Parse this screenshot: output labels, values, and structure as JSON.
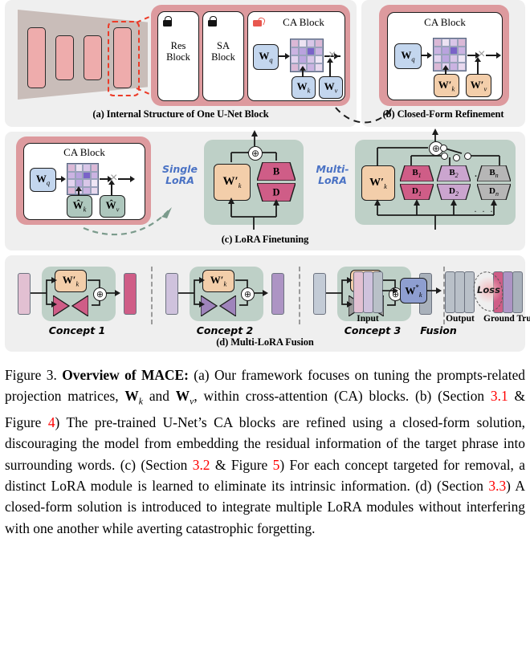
{
  "figure": {
    "panels": {
      "a": {
        "label": "(a) Internal Structure of One U-Net Block",
        "blocks": [
          {
            "name_line1": "Res",
            "name_line2": "Block",
            "lock": "closed-lock-icon"
          },
          {
            "name_line1": "SA",
            "name_line2": "Block",
            "lock": "closed-lock-icon"
          }
        ],
        "ca_title": "CA Block",
        "ca_lock": "open-lock-icon",
        "nodes": {
          "wq": "W",
          "wq_sub": "q",
          "wk": "W",
          "wk_sub": "k",
          "wv": "W",
          "wv_sub": "v"
        },
        "multiply_symbol": "×"
      },
      "b": {
        "label": "(b) Closed-Form Refinement",
        "ca_title": "CA Block",
        "nodes": {
          "wq": "W",
          "wq_sub": "q",
          "wk": "W′",
          "wk_sub": "k",
          "wv": "W′",
          "wv_sub": "v"
        },
        "multiply_symbol": "×"
      },
      "c": {
        "label": "(c) LoRA Finetuning",
        "ca_title": "CA Block",
        "nodes": {
          "wq": "W",
          "wq_sub": "q",
          "wk": "Ŵ",
          "wk_sub": "k",
          "wv": "Ŵ",
          "wv_sub": "v"
        },
        "multiply_symbol": "×",
        "single_lora_label": "Single\nLoRA",
        "single_lora_line1": "Single",
        "single_lora_line2": "LoRA",
        "multi_lora_line1": "Multi-",
        "multi_lora_line2": "LoRA",
        "single": {
          "w": "W′",
          "w_sub": "k",
          "b": "B",
          "d": "D"
        },
        "multi": {
          "w": "W′",
          "w_sub": "k",
          "pairs": [
            {
              "b": "B",
              "b_sub": "1",
              "d": "D",
              "d_sub": "1",
              "color": "#cf5d87"
            },
            {
              "b": "B",
              "b_sub": "2",
              "d": "D",
              "d_sub": "2",
              "color": "#cba5cf"
            },
            {
              "b": "B",
              "b_sub": "n",
              "d": "D",
              "d_sub": "n",
              "color": "#b6b6b6"
            }
          ],
          "ellipsis": "· · ·"
        },
        "sum_symbol": "⊕"
      },
      "d": {
        "label": "(d) Multi-LoRA Fusion",
        "concepts": [
          {
            "name": "Concept 1",
            "color": "#cf5d87",
            "in_color": "#e2c0d2"
          },
          {
            "name": "Concept 2",
            "color": "#9f84bb",
            "in_color": "#cfc2dd"
          },
          {
            "name": "Concept 3",
            "color": "#9a9a9a",
            "in_color": "#c3cbd6"
          }
        ],
        "concept_node": {
          "w": "W′",
          "w_sub": "k"
        },
        "sum_symbol": "⊕",
        "fusion": {
          "title": "Fusion",
          "input_label": "Input",
          "output_label": "Output",
          "gt_label": "Ground Truth",
          "loss_label": "Loss",
          "node": {
            "w": "W",
            "w_sup": "*",
            "w_sub": "k"
          },
          "input_colors": [
            "#e2c0d2",
            "#cfc2dd",
            "#b9c0c8"
          ],
          "output_colors": [
            "#b9c0c8",
            "#b9c0c8",
            "#b9c0c8"
          ],
          "gt_colors": [
            "#cf5d87",
            "#ad94c4",
            "#a9b1bb"
          ]
        }
      }
    }
  },
  "caption": {
    "prefix": "Figure 3. ",
    "bold_title": "Overview of MACE:",
    "seg1": " (a) Our framework focuses on tuning the prompts-related projection matrices, ",
    "math1": "W",
    "math1_sub": "k",
    "seg2": " and ",
    "math2": "W",
    "math2_sub": "v",
    "seg3": ", within cross-attention (CA) blocks. (b) (Section ",
    "ref1": "3.1",
    "seg4": " & Figure ",
    "ref2": "4",
    "seg5": ") The pre-trained U-Net’s CA blocks are refined using a closed-form solution, discouraging the model from embedding the residual information of the target phrase into surrounding words. (c) (Section ",
    "ref3": "3.2",
    "seg6": " & Figure ",
    "ref4": "5",
    "seg7": ") For each concept targeted for removal, a distinct LoRA module is learned to eliminate its intrinsic information. (d) (Section ",
    "ref5": "3.3",
    "seg8": ") A closed-form solution is introduced to integrate multiple LoRA modules without interfering with one another while averting catastrophic forgetting."
  },
  "colors": {
    "panel_bg": "#efefef",
    "ca_frame": "#dd9a9e",
    "unet_body": "#c9bdb9",
    "unet_block": "#eeacac",
    "dashed_red": "#ec3b28",
    "blue_node": "#c3d6ee",
    "tan_node": "#f3ceaa",
    "sage_node": "#aec7bd",
    "green_box": "#bed0c7",
    "periwinkle": "#8e9ed0",
    "handwriting_blue": "#4a72c4",
    "reference_red": "#ff0000"
  }
}
